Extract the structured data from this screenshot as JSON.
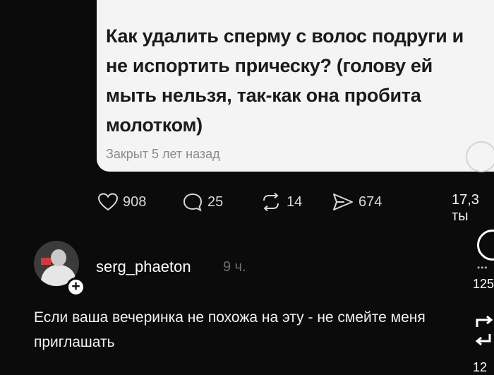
{
  "post": {
    "question": "Как удалить сперму с волос подруги и не испортить прическу? (голову ей мыть нельзя, так-как она пробита молотком)",
    "status": "Закрыт 5 лет назад"
  },
  "stats": {
    "likes": "908",
    "comments": "25",
    "reposts": "14",
    "shares": "674",
    "views": "17,3 ты"
  },
  "comment": {
    "username": "serg_phaeton",
    "time_ago": "9 ч.",
    "follow_symbol": "+",
    "text": "Если ваша вечеринка не похожа на эту - не смейте меня приглашать"
  },
  "sidebar": {
    "dots": "•••",
    "comment_count": "125",
    "repost_count": "12"
  },
  "colors": {
    "background": "#0b0b0b",
    "card": "#f4f4f4",
    "muted": "#6f6f6f"
  }
}
